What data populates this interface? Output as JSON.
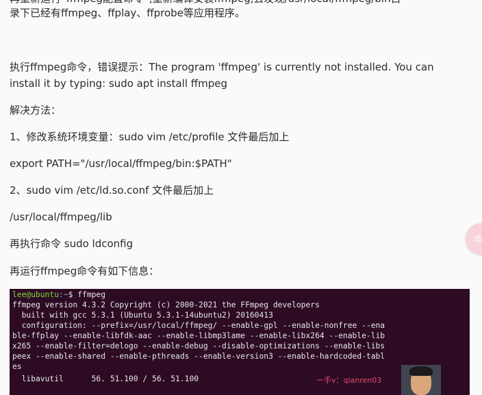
{
  "article": {
    "top_cut": "再重新运行“ffmpeg配置命令”,重新编译安装ffmpeg,去发现/usr/local/ffmpeg/bin目",
    "line1": "录下已经有ffmpeg、ffplay、ffprobe等应用程序。",
    "error_line1": "执行ffmpeg命令，错误提示：The program 'ffmpeg' is currently not installed. You can",
    "error_line2": "install it by typing:   sudo apt install ffmpeg",
    "solution_heading": "解决方法：",
    "step1": "1、修改系统环境变量：sudo vim /etc/profile 文件最后加上",
    "export_line": "export PATH=\"/usr/local/ffmpeg/bin:$PATH\"",
    "step2": "2、sudo vim /etc/ld.so.conf 文件最后加上",
    "lib_path": "/usr/local/ffmpeg/lib",
    "ldconfig_line": "再执行命令 sudo ldconfig",
    "run_again": "再运行ffmpeg命令有如下信息："
  },
  "side_float": {
    "label": "中"
  },
  "terminal": {
    "prompt_user": "lee@ubuntu",
    "prompt_path": ":~",
    "prompt_cmd": "$ ffmpeg",
    "lines": [
      "ffmpeg version 4.3.2 Copyright (c) 2000-2021 the FFmpeg developers",
      "  built with gcc 5.3.1 (Ubuntu 5.3.1-14ubuntu2) 20160413",
      "  configuration: --prefix=/usr/local/ffmpeg/ --enable-gpl --enable-nonfree --ena",
      "ble-ffplay --enable-libfdk-aac --enable-libmp3lame --enable-libx264 --enable-lib",
      "x265 --enable-filter=delogo --enable-debug --disable-optimizations --enable-libs",
      "peex --enable-shared --enable-pthreads --enable-version3 --enable-hardcoded-tabl",
      "es",
      "  libavutil      56. 51.100 / 56. 51.100"
    ]
  },
  "watermark": {
    "text": "一手v：qianren03"
  },
  "colors": {
    "terminal_bg": "#2c0b23",
    "prompt_user": "#7fd934",
    "prompt_path": "#7ea6e0",
    "watermark": "#e34b6a"
  }
}
